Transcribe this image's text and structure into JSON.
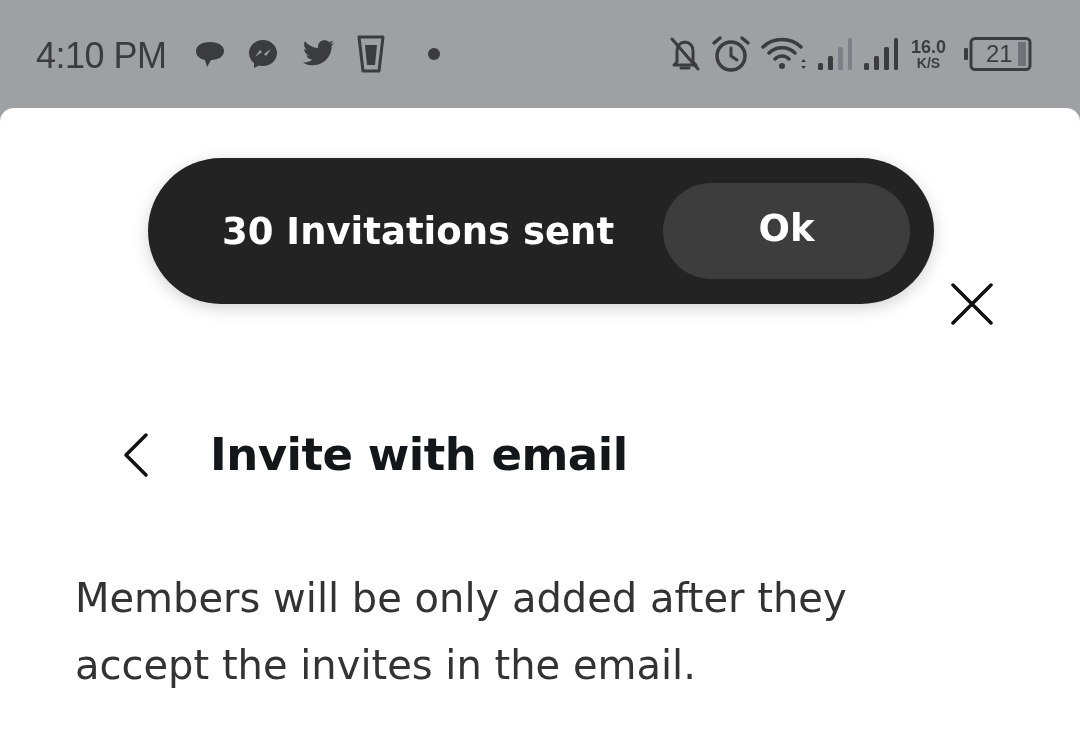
{
  "status_bar": {
    "time": "4:10 PM",
    "network_speed": {
      "value": "16.0",
      "unit": "K/S"
    },
    "battery": "21"
  },
  "toast": {
    "message": "30 Invitations sent",
    "action": "Ok"
  },
  "header": {
    "title": "Invite with email"
  },
  "description": "Members will be only added after they accept the invites in the email."
}
